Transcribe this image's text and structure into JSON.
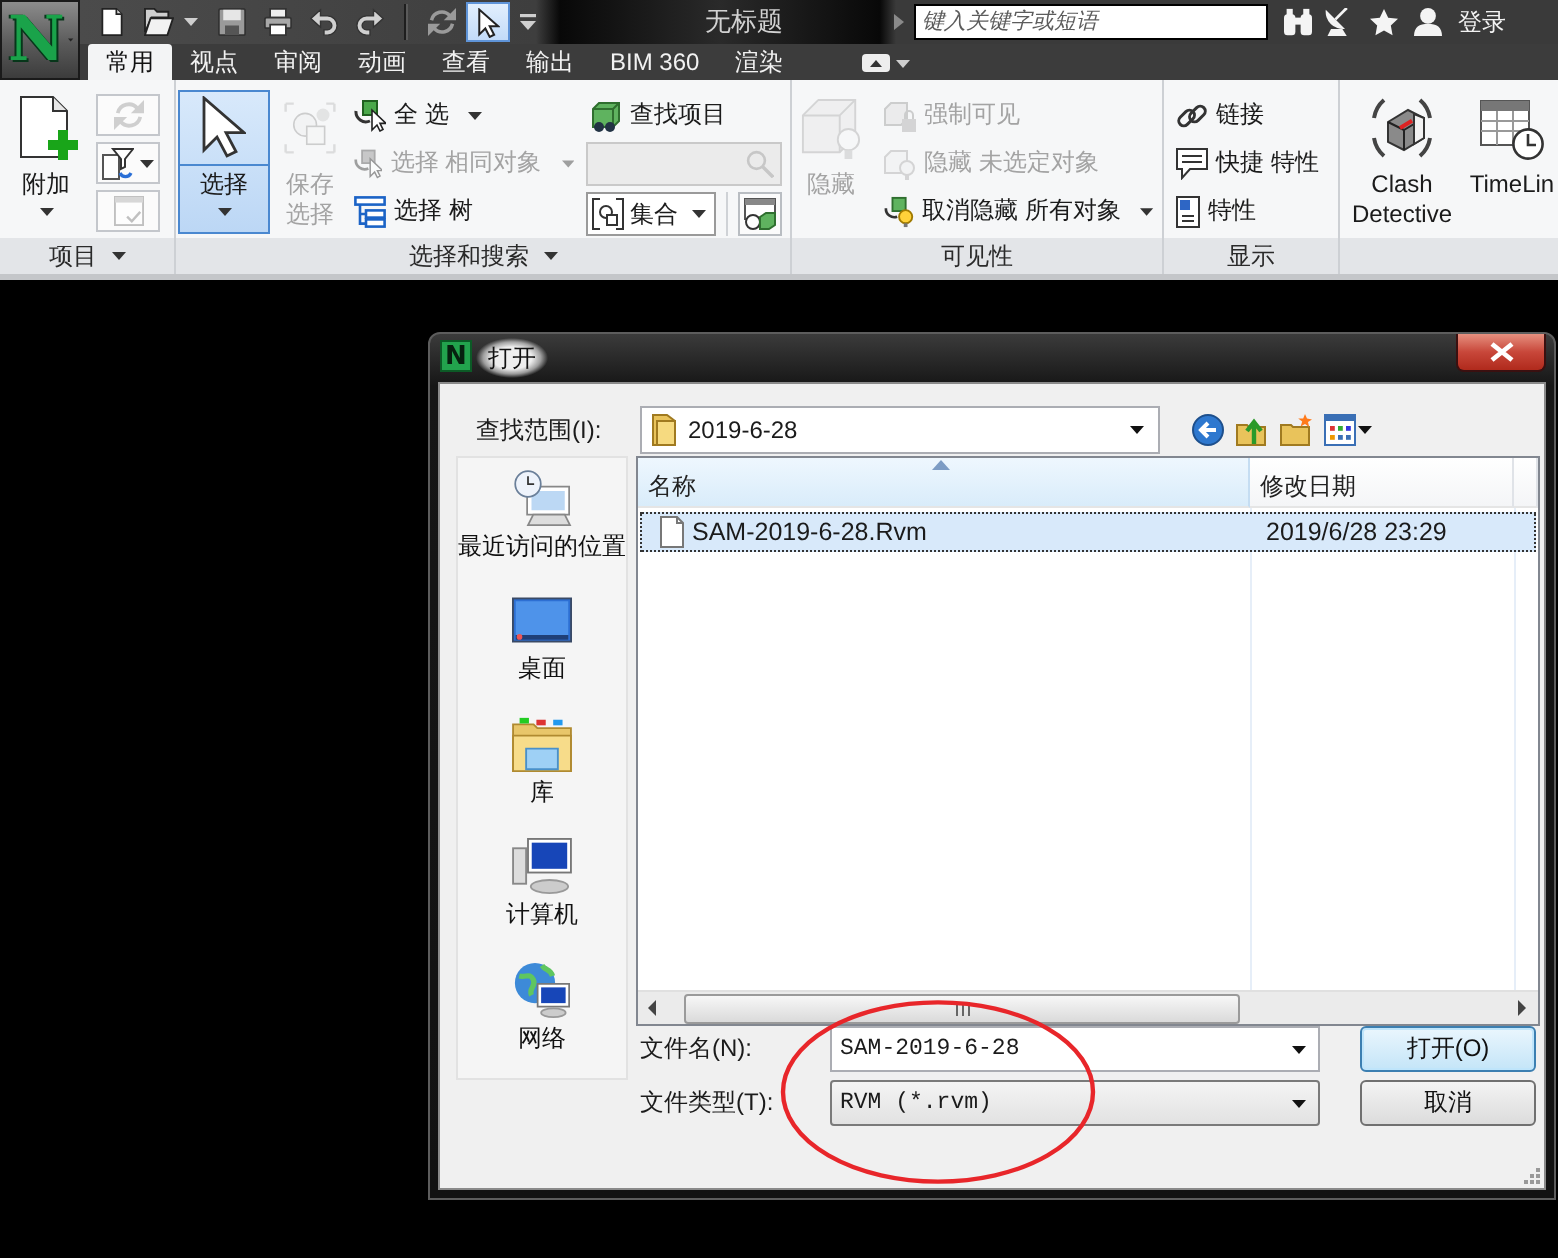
{
  "title_bar": {
    "app_logo": "N",
    "quick_access": [
      {
        "kind": "new",
        "active": false
      },
      {
        "kind": "open",
        "active": false
      },
      {
        "kind": "save",
        "active": false
      },
      {
        "kind": "print",
        "active": false
      },
      {
        "kind": "undo",
        "active": false
      },
      {
        "kind": "redo",
        "active": false
      },
      {
        "kind": "refresh",
        "active": false
      },
      {
        "kind": "select",
        "active": true
      }
    ],
    "title": "无标题",
    "search": {
      "placeholder": "键入关键字或短语"
    },
    "sign_in": "登录"
  },
  "ribbon": {
    "tabs": [
      {
        "label": "常用",
        "selected": true
      },
      {
        "label": "视点",
        "selected": false
      },
      {
        "label": "审阅",
        "selected": false
      },
      {
        "label": "动画",
        "selected": false
      },
      {
        "label": "查看",
        "selected": false
      },
      {
        "label": "输出",
        "selected": false
      },
      {
        "label": "BIM 360",
        "selected": false
      },
      {
        "label": "渲染",
        "selected": false
      }
    ],
    "panels": [
      {
        "title": "项目",
        "menu": true,
        "columns": [
          [
            {
              "kind": "large",
              "label": "附加",
              "menu": true,
              "active": false,
              "disabled": false
            }
          ],
          [
            {
              "kind": "icon",
              "menu": false,
              "disabled": true
            },
            {
              "kind": "icon",
              "menu": true,
              "disabled": false
            },
            {
              "kind": "icon",
              "menu": false,
              "disabled": true
            }
          ]
        ]
      },
      {
        "title": "选择和搜索",
        "menu": true,
        "columns": [
          [
            {
              "kind": "large",
              "label": "选择",
              "menu": true,
              "active": true,
              "disabled": false
            }
          ],
          [
            {
              "kind": "large",
              "label": "保存选择",
              "menu": false,
              "active": false,
              "disabled": true
            }
          ],
          [
            {
              "kind": "small",
              "label": "全 选",
              "menu": true,
              "disabled": false
            },
            {
              "kind": "small",
              "label": "选择 相同对象",
              "menu": true,
              "disabled": true
            },
            {
              "kind": "small",
              "label": "选择 树",
              "menu": false,
              "disabled": false
            }
          ],
          [
            {
              "kind": "small",
              "label": "查找项目",
              "menu": false,
              "disabled": false
            },
            {
              "kind": "field",
              "disabled": true
            },
            {
              "kind": "combo",
              "label": "集合",
              "disabled": false
            }
          ]
        ]
      },
      {
        "title": "可见性",
        "menu": false,
        "columns": [
          [
            {
              "kind": "large",
              "label": "隐藏",
              "menu": false,
              "active": false,
              "disabled": true
            }
          ],
          [
            {
              "kind": "small",
              "label": "强制可见",
              "menu": false,
              "disabled": true
            },
            {
              "kind": "small",
              "label": "隐藏 未选定对象",
              "menu": false,
              "disabled": true
            },
            {
              "kind": "small",
              "label": "取消隐藏 所有对象",
              "menu": true,
              "disabled": false
            }
          ]
        ]
      },
      {
        "title": "显示",
        "menu": false,
        "columns": [
          [
            {
              "kind": "small",
              "label": "链接",
              "menu": false,
              "disabled": false
            },
            {
              "kind": "small",
              "label": "快捷 特性",
              "menu": false,
              "disabled": false
            },
            {
              "kind": "small",
              "label": "特性",
              "menu": false,
              "disabled": false
            }
          ]
        ]
      },
      {
        "columns": [
          [
            {
              "kind": "large",
              "label": "Clash Detective",
              "menu": false,
              "active": false,
              "disabled": false
            }
          ],
          [
            {
              "kind": "large",
              "label": "TimeLin",
              "menu": false,
              "active": false,
              "disabled": false
            }
          ]
        ]
      }
    ]
  },
  "dialog": {
    "app_logo": "N",
    "title": "打开",
    "look_in": {
      "label": "查找范围(I):",
      "value": "2019-6-28"
    },
    "places": [
      {
        "label": "最近访问的位置"
      },
      {
        "label": "桌面"
      },
      {
        "label": "库"
      },
      {
        "label": "计算机"
      },
      {
        "label": "网络"
      }
    ],
    "file_list": {
      "columns": [
        {
          "label": "名称",
          "sorted": true
        },
        {
          "label": "修改日期",
          "sorted": false
        }
      ],
      "rows": [
        {
          "name": "SAM-2019-6-28.Rvm",
          "modified": "2019/6/28 23:29",
          "selected": true
        }
      ]
    },
    "file_name": {
      "label": "文件名(N):",
      "value": "SAM-2019-6-28"
    },
    "file_type": {
      "label": "文件类型(T):",
      "value": "RVM (*.rvm)"
    },
    "buttons": [
      {
        "label": "打开(O)",
        "default": true
      },
      {
        "label": "取消",
        "default": false
      }
    ],
    "annotations": [
      {
        "kind": "ellipse"
      }
    ]
  }
}
